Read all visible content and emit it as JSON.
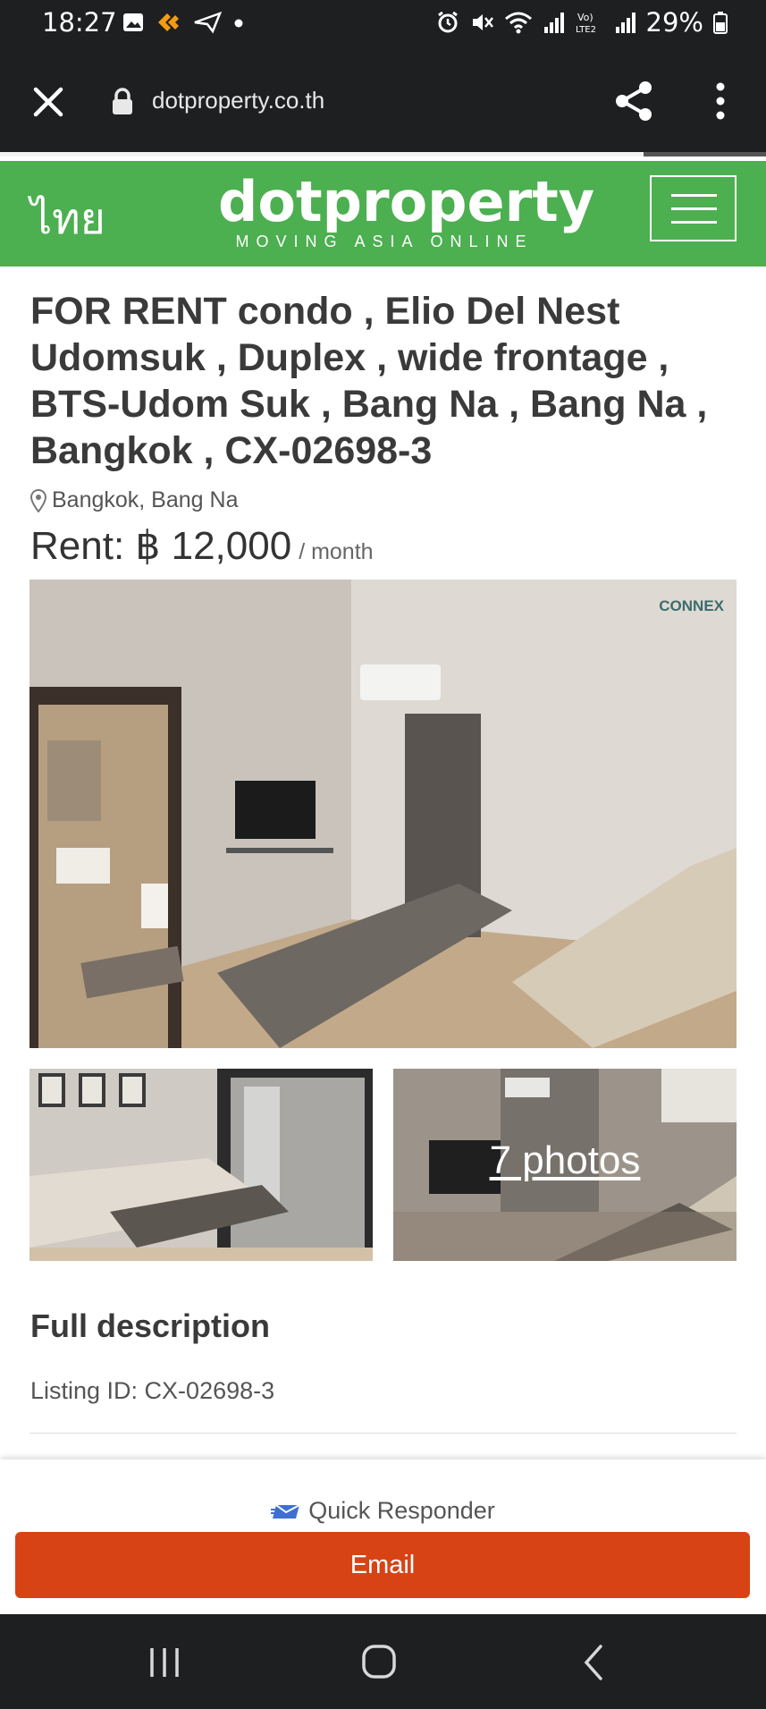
{
  "status_bar": {
    "time": "18:27",
    "battery": "29%",
    "left_icons": [
      "gallery-icon",
      "app-notification-icon",
      "send-icon",
      "dot-icon"
    ],
    "right_icons": [
      "alarm-icon",
      "mute-icon",
      "wifi-icon",
      "signal-icon",
      "volte-icon",
      "signal-icon",
      "battery-icon"
    ]
  },
  "browser": {
    "url": "dotproperty.co.th",
    "load_progress": 0.84
  },
  "header": {
    "lang_label": "ไทย",
    "logo_text": "dotproperty",
    "logo_tagline": "MOVING ASIA ONLINE",
    "brand_color": "#4caf50"
  },
  "listing": {
    "title": "FOR RENT condo , Elio Del Nest Udomsuk , Duplex , wide frontage , BTS-Udom Suk , Bang Na , Bang Na , Bangkok , CX-02698-3",
    "location": "Bangkok, Bang Na",
    "price_label": "Rent: ฿ 12,000",
    "price_period": "/ month",
    "photo_watermark": "CONNEX",
    "photos_link": "7 photos"
  },
  "description": {
    "heading": "Full description",
    "listing_id": "Listing ID: CX-02698-3"
  },
  "footer": {
    "responder_label": "Quick Responder",
    "email_button": "Email",
    "email_color": "#d84315"
  }
}
